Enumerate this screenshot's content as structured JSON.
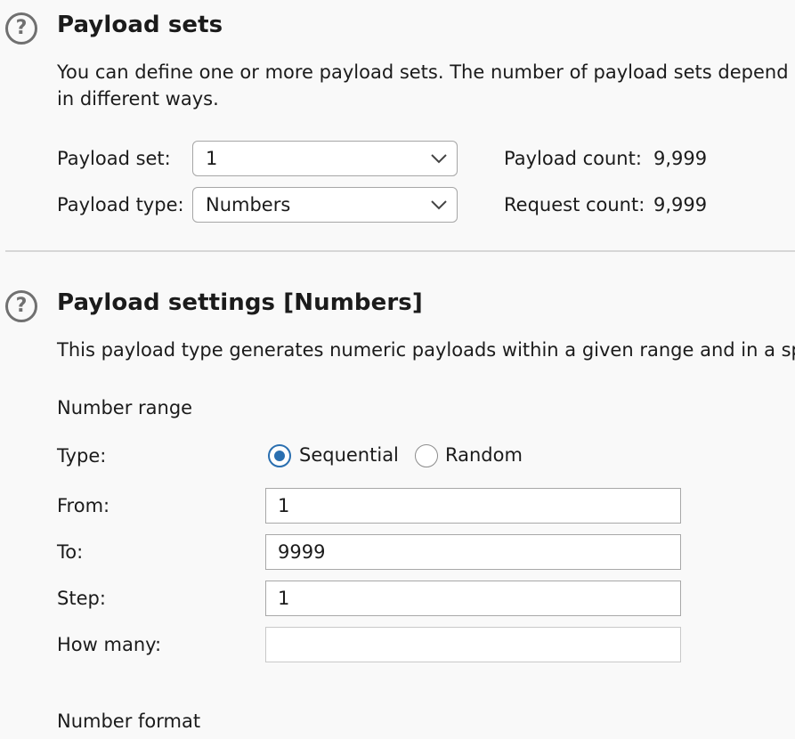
{
  "payload_sets": {
    "title": "Payload sets",
    "description_line1": "You can define one or more payload sets. The number of payload sets depend",
    "description_line2": "in different ways.",
    "payload_set_label": "Payload set:",
    "payload_set_value": "1",
    "payload_type_label": "Payload type:",
    "payload_type_value": "Numbers",
    "payload_count_label": "Payload count:",
    "payload_count_value": "9,999",
    "request_count_label": "Request count:",
    "request_count_value": "9,999"
  },
  "payload_settings": {
    "title": "Payload settings [Numbers]",
    "description": "This payload type generates numeric payloads within a given range and in a sp",
    "number_range_heading": "Number range",
    "type_label": "Type:",
    "type_options": [
      "Sequential",
      "Random"
    ],
    "type_selected": "Sequential",
    "from_label": "From:",
    "from_value": "1",
    "to_label": "To:",
    "to_value": "9999",
    "step_label": "Step:",
    "step_value": "1",
    "how_many_label": "How many:",
    "how_many_value": "",
    "number_format_heading": "Number format"
  },
  "icons": {
    "help": "help-question-icon",
    "dropdown": "chevron-down-icon"
  },
  "colors": {
    "accent": "#2a6fb0",
    "background": "#f9f9f9"
  }
}
